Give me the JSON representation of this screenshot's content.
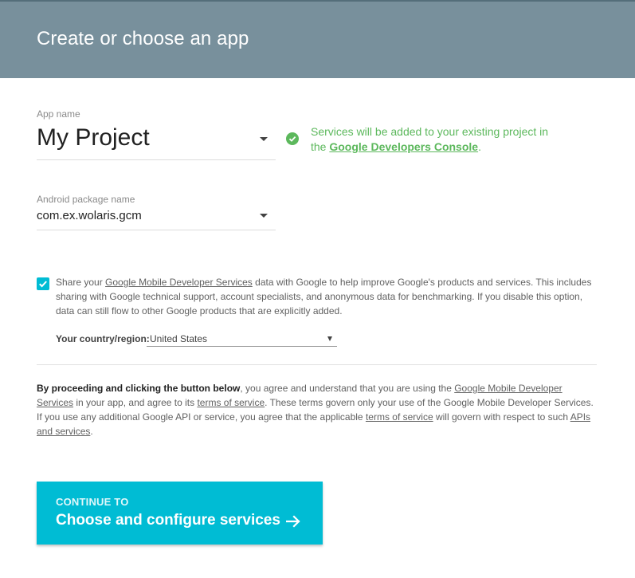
{
  "header": {
    "title": "Create or choose an app"
  },
  "app_name": {
    "label": "App name",
    "value": "My Project"
  },
  "notice": {
    "text_before": "Services will be added to your existing project in the ",
    "link": "Google Developers Console",
    "text_after": ".",
    "color": "#5cb85c"
  },
  "package": {
    "label": "Android package name",
    "value": "com.ex.wolaris.gcm"
  },
  "share": {
    "checked": true,
    "prefix": "Share your ",
    "link": "Google Mobile Developer Services",
    "suffix": " data with Google to help improve Google's products and services. This includes sharing with Google technical support, account specialists, and anonymous data for benchmarking. If you disable this option, data can still flow to other Google products that are explicitly added."
  },
  "country": {
    "label": "Your country/region:",
    "value": "United States"
  },
  "tos": {
    "bold": "By proceeding and clicking the button below",
    "t1": ", you agree and understand that you are using the ",
    "link1": "Google Mobile Developer Services",
    "t2": " in your app, and agree to its ",
    "link2": "terms of service",
    "t3": ". These terms govern only your use of the Google Mobile Developer Services. If you use any additional Google API or service, you agree that the applicable ",
    "link3": "terms of service",
    "t4": " will govern with respect to such ",
    "link4": "APIs and services",
    "t5": "."
  },
  "cta": {
    "small": "CONTINUE TO",
    "big": "Choose and configure services",
    "color": "#00bcd4"
  },
  "icons": {
    "notice": "check-circle-icon",
    "cta": "arrow-right-icon",
    "checkbox": "checkmark-icon"
  }
}
